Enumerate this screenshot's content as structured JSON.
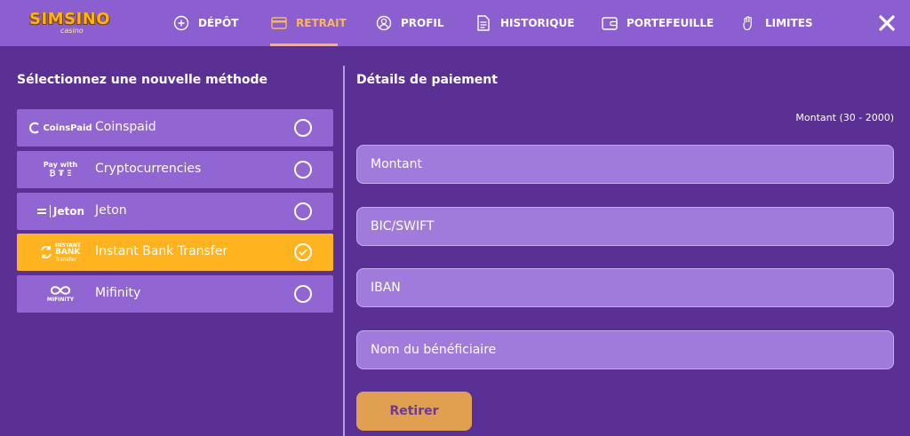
{
  "brand": {
    "name": "SIMSINO",
    "sub": "casino"
  },
  "nav": [
    {
      "label": "DÉPÔT",
      "icon": "plus-circle-icon"
    },
    {
      "label": "RETRAIT",
      "icon": "card-icon",
      "active": true
    },
    {
      "label": "PROFIL",
      "icon": "user-icon"
    },
    {
      "label": "HISTORIQUE",
      "icon": "document-icon"
    },
    {
      "label": "PORTEFEUILLE",
      "icon": "wallet-icon"
    },
    {
      "label": "LIMITES",
      "icon": "hand-icon"
    }
  ],
  "left": {
    "title": "Sélectionnez une nouvelle méthode",
    "methods": [
      {
        "label": "Coinspaid",
        "logo": {
          "text": "CoinsPaid"
        }
      },
      {
        "label": "Cryptocurrencies",
        "logo": {
          "line1": "Pay with",
          "coins": "₿ ₮ Ξ"
        }
      },
      {
        "label": "Jeton",
        "logo": {
          "text": "Jeton"
        }
      },
      {
        "label": "Instant Bank Transfer",
        "selected": true,
        "logo": {
          "line1": "INSTANT",
          "line2": "BANK",
          "line3": "Transfer"
        }
      },
      {
        "label": "Mifinity",
        "logo": {
          "text": "MIFINITY"
        }
      }
    ]
  },
  "right": {
    "title": "Détails de paiement",
    "amount_range": "Montant (30 - 2000)",
    "fields": {
      "amount": {
        "placeholder": "Montant"
      },
      "bic": {
        "placeholder": "BIC/SWIFT"
      },
      "iban": {
        "placeholder": "IBAN"
      },
      "beneficiary": {
        "placeholder": "Nom du bénéficiaire"
      }
    },
    "submit_label": "Retirer"
  },
  "colors": {
    "background": "#5a3094",
    "topbar": "#8b5fcf",
    "accent": "#ffb31f",
    "active_nav": "#ffb74d",
    "button": "#e0a04f"
  }
}
